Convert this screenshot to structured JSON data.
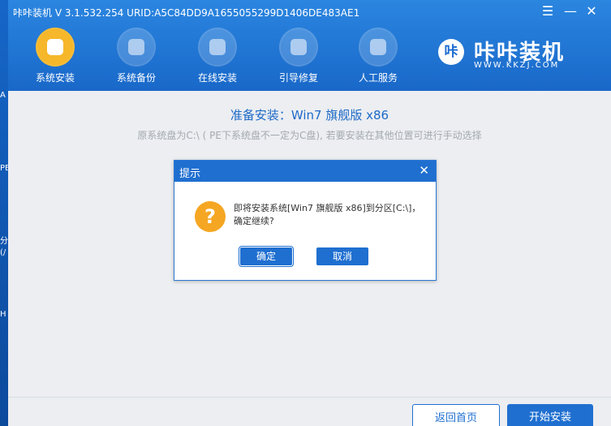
{
  "desktop": {
    "glyphs": [
      "A",
      "PE",
      "分",
      "(/",
      "H"
    ]
  },
  "window": {
    "title": "咔咔装机 V 3.1.532.254 URID:A5C84DD9A1655055299D1406DE483AE1",
    "controls": {
      "menu": "☰",
      "minimize": "—",
      "close": "✕"
    }
  },
  "nav": {
    "items": [
      {
        "label": "系统安装",
        "icon": "system-install-icon",
        "active": true
      },
      {
        "label": "系统备份",
        "icon": "system-backup-icon",
        "active": false
      },
      {
        "label": "在线安装",
        "icon": "online-install-icon",
        "active": false
      },
      {
        "label": "引导修复",
        "icon": "boot-repair-icon",
        "active": false
      },
      {
        "label": "人工服务",
        "icon": "chat-service-icon",
        "active": false
      }
    ]
  },
  "logo": {
    "mark": "咔",
    "name": "咔咔装机",
    "url": "WWW.KKZJ.COM"
  },
  "content": {
    "title": "准备安装：Win7 旗舰版 x86",
    "subtitle": "原系统盘为C:\\ ( PE下系统盘不一定为C盘), 若要安装在其他位置可进行手动选择"
  },
  "dialog": {
    "title": "提示",
    "close": "✕",
    "icon": "question-icon",
    "icon_glyph": "?",
    "message": "即将安装系统[Win7 旗舰版 x86]到分区[C:\\]，确定继续?",
    "ok_label": "确定",
    "cancel_label": "取消"
  },
  "footer": {
    "home_label": "返回首页",
    "start_label": "开始安装"
  },
  "colors": {
    "primary": "#1f6fd0",
    "header": "#2b86e0",
    "active_icon": "#f6b72a",
    "question": "#f5a623"
  }
}
